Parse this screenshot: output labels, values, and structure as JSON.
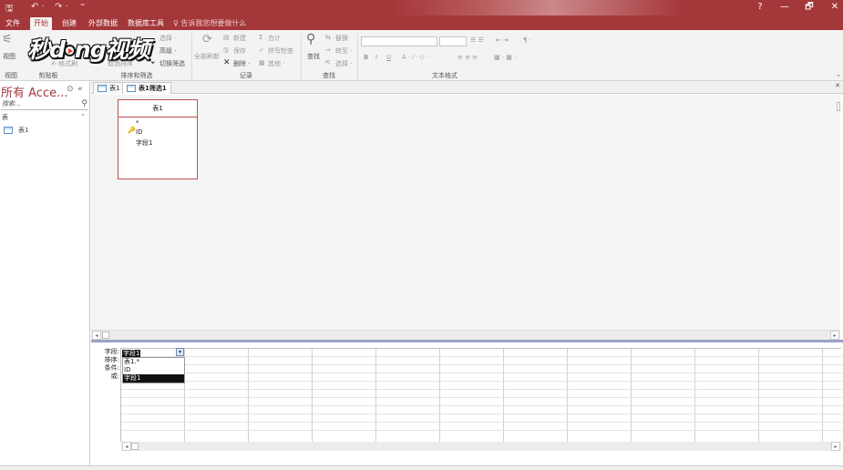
{
  "titlebar": {
    "help": "?",
    "minimize": "—",
    "restore": "🗗",
    "close": "✕"
  },
  "tabs": [
    {
      "label": "文件"
    },
    {
      "label": "开始"
    },
    {
      "label": "创建"
    },
    {
      "label": "外部数据"
    },
    {
      "label": "数据库工具"
    }
  ],
  "tell_me": "♀ 告诉我您想要做什么",
  "watermark": {
    "part1": "秒d",
    "part2": "ng视频"
  },
  "ribbon": {
    "view": "视图",
    "paste": "粘贴",
    "format_painter": "✍ 格式刷",
    "select": "选择 ·",
    "advanced": "高级 ·",
    "toggle_filter": "切换筛选",
    "remove_sort": "取消排序",
    "refresh_all": "全部刷新",
    "new": "新建",
    "save": "保存",
    "delete": "删除 ·",
    "totals": "合计",
    "spelling": "拼写检查",
    "more": "其他 ·",
    "find": "查找",
    "replace": "替换",
    "goto": "转至 ·",
    "select_find": "选择 ·",
    "bold": "B",
    "italic": "I",
    "underline": "U",
    "groups": {
      "views": "视图",
      "clipboard": "剪贴板",
      "sort_filter": "排序和筛选",
      "records": "记录",
      "find": "查找",
      "text_format": "文本格式"
    }
  },
  "nav": {
    "title": "所有 Acce...",
    "search_placeholder": "搜索...",
    "category": "表",
    "items": [
      {
        "label": "表1"
      }
    ]
  },
  "doc_tabs": [
    {
      "label": "表1"
    },
    {
      "label": "表1筛选1"
    }
  ],
  "field_list": {
    "title": "表1",
    "fields": [
      "*",
      "ID",
      "字段1"
    ]
  },
  "grid": {
    "row_labels": [
      "字段:",
      "排序:",
      "条件:",
      "或:"
    ],
    "current_value": "字段1",
    "dropdown_options": [
      "表1.*",
      "ID",
      "字段1"
    ]
  }
}
